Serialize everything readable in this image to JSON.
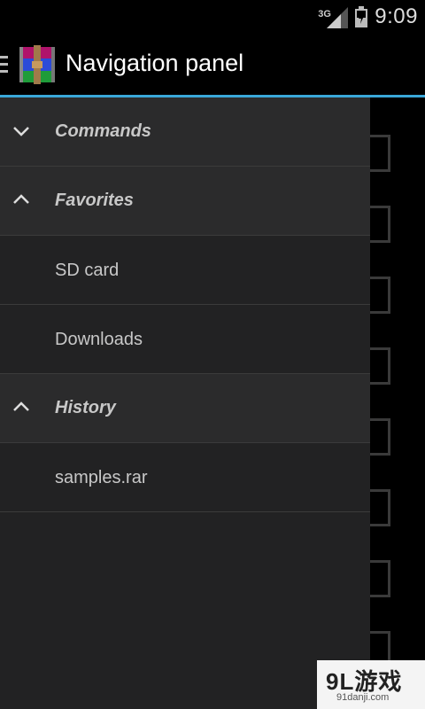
{
  "status_bar": {
    "network": "3G",
    "time": "9:09"
  },
  "action_bar": {
    "title": "Navigation panel",
    "app_icon": "winrar-books-icon",
    "accent_color": "#3aa7d8"
  },
  "drawer": {
    "sections": [
      {
        "label": "Commands",
        "expanded": false,
        "chevron": "chevron-down-icon",
        "items": []
      },
      {
        "label": "Favorites",
        "expanded": true,
        "chevron": "chevron-up-icon",
        "items": [
          {
            "label": "SD card"
          },
          {
            "label": "Downloads"
          }
        ]
      },
      {
        "label": "History",
        "expanded": true,
        "chevron": "chevron-up-icon",
        "items": [
          {
            "label": "samples.rar"
          }
        ]
      }
    ]
  },
  "watermark": {
    "main": "9L游戏",
    "sub": "91danji.com"
  }
}
